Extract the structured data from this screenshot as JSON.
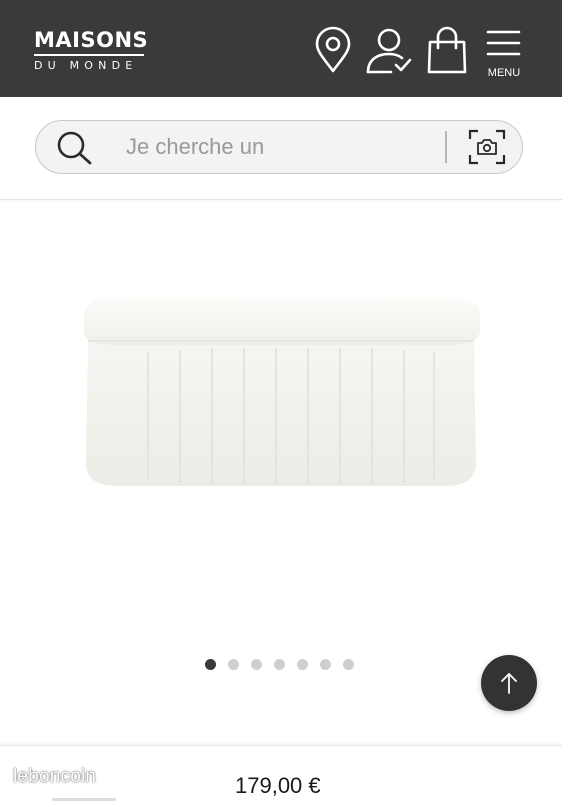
{
  "header": {
    "logo_main": "MAISONS",
    "logo_sub": "DU MONDE",
    "menu_label": "MENU",
    "icons": [
      "location-pin-icon",
      "account-icon",
      "shopping-bag-icon",
      "hamburger-menu-icon"
    ],
    "background_color": "#3a3a3a"
  },
  "search": {
    "placeholder": "Je cherche un",
    "value": "",
    "icons": [
      "search-icon",
      "camera-search-icon"
    ]
  },
  "product": {
    "image_description_icon": "storage-bench-image",
    "gallery": {
      "total_images": 7,
      "active_index": 0
    },
    "price": "179,00 €"
  },
  "scroll_top": {
    "icon": "arrow-up-icon"
  },
  "watermark": "leboncoin"
}
